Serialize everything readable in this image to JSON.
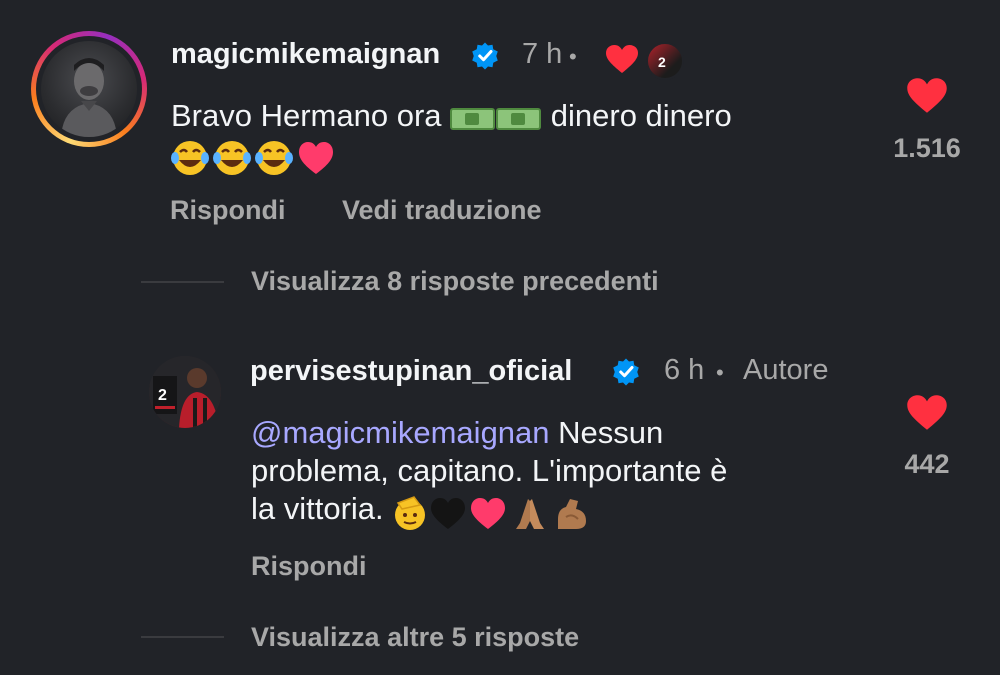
{
  "comments": [
    {
      "username": "magicmikemaignan",
      "verified": true,
      "time": "7 h",
      "separator": "•",
      "text": "Bravo Hermano ora 💵💵 dinero dinero",
      "text_main": "Bravo Hermano ora",
      "text_after": "dinero dinero",
      "text_line2_emojis": "😂😂😂❤️",
      "likes": "1.516",
      "actions": {
        "reply": "Rispondi",
        "translate": "Vedi traduzione"
      },
      "liked_by_author_icon": "red-heart-icon"
    },
    {
      "username": "pervisestupinan_oficial",
      "verified": true,
      "time": "6 h",
      "separator": "•",
      "author_badge": "Autore",
      "mention": "@magicmikemaignan",
      "text_line1": "Nessun",
      "text_line2": "problema, capitano. L'importante è",
      "text_line3": "la vittoria.",
      "text_line3_emojis": "🫡🖤❤️🙏🏽💪🏽",
      "likes": "442",
      "actions": {
        "reply": "Rispondi"
      }
    }
  ],
  "view_previous_replies": "Visualizza 8 risposte precedenti",
  "view_more_replies": "Visualizza altre 5 risposte",
  "colors": {
    "background": "#212328",
    "text": "#f3f5f7",
    "secondary": "#a8a8a8",
    "mention": "#a8a8ff",
    "like": "#ff3040",
    "verified": "#0095f6"
  },
  "avatar_jersey_number": "2"
}
